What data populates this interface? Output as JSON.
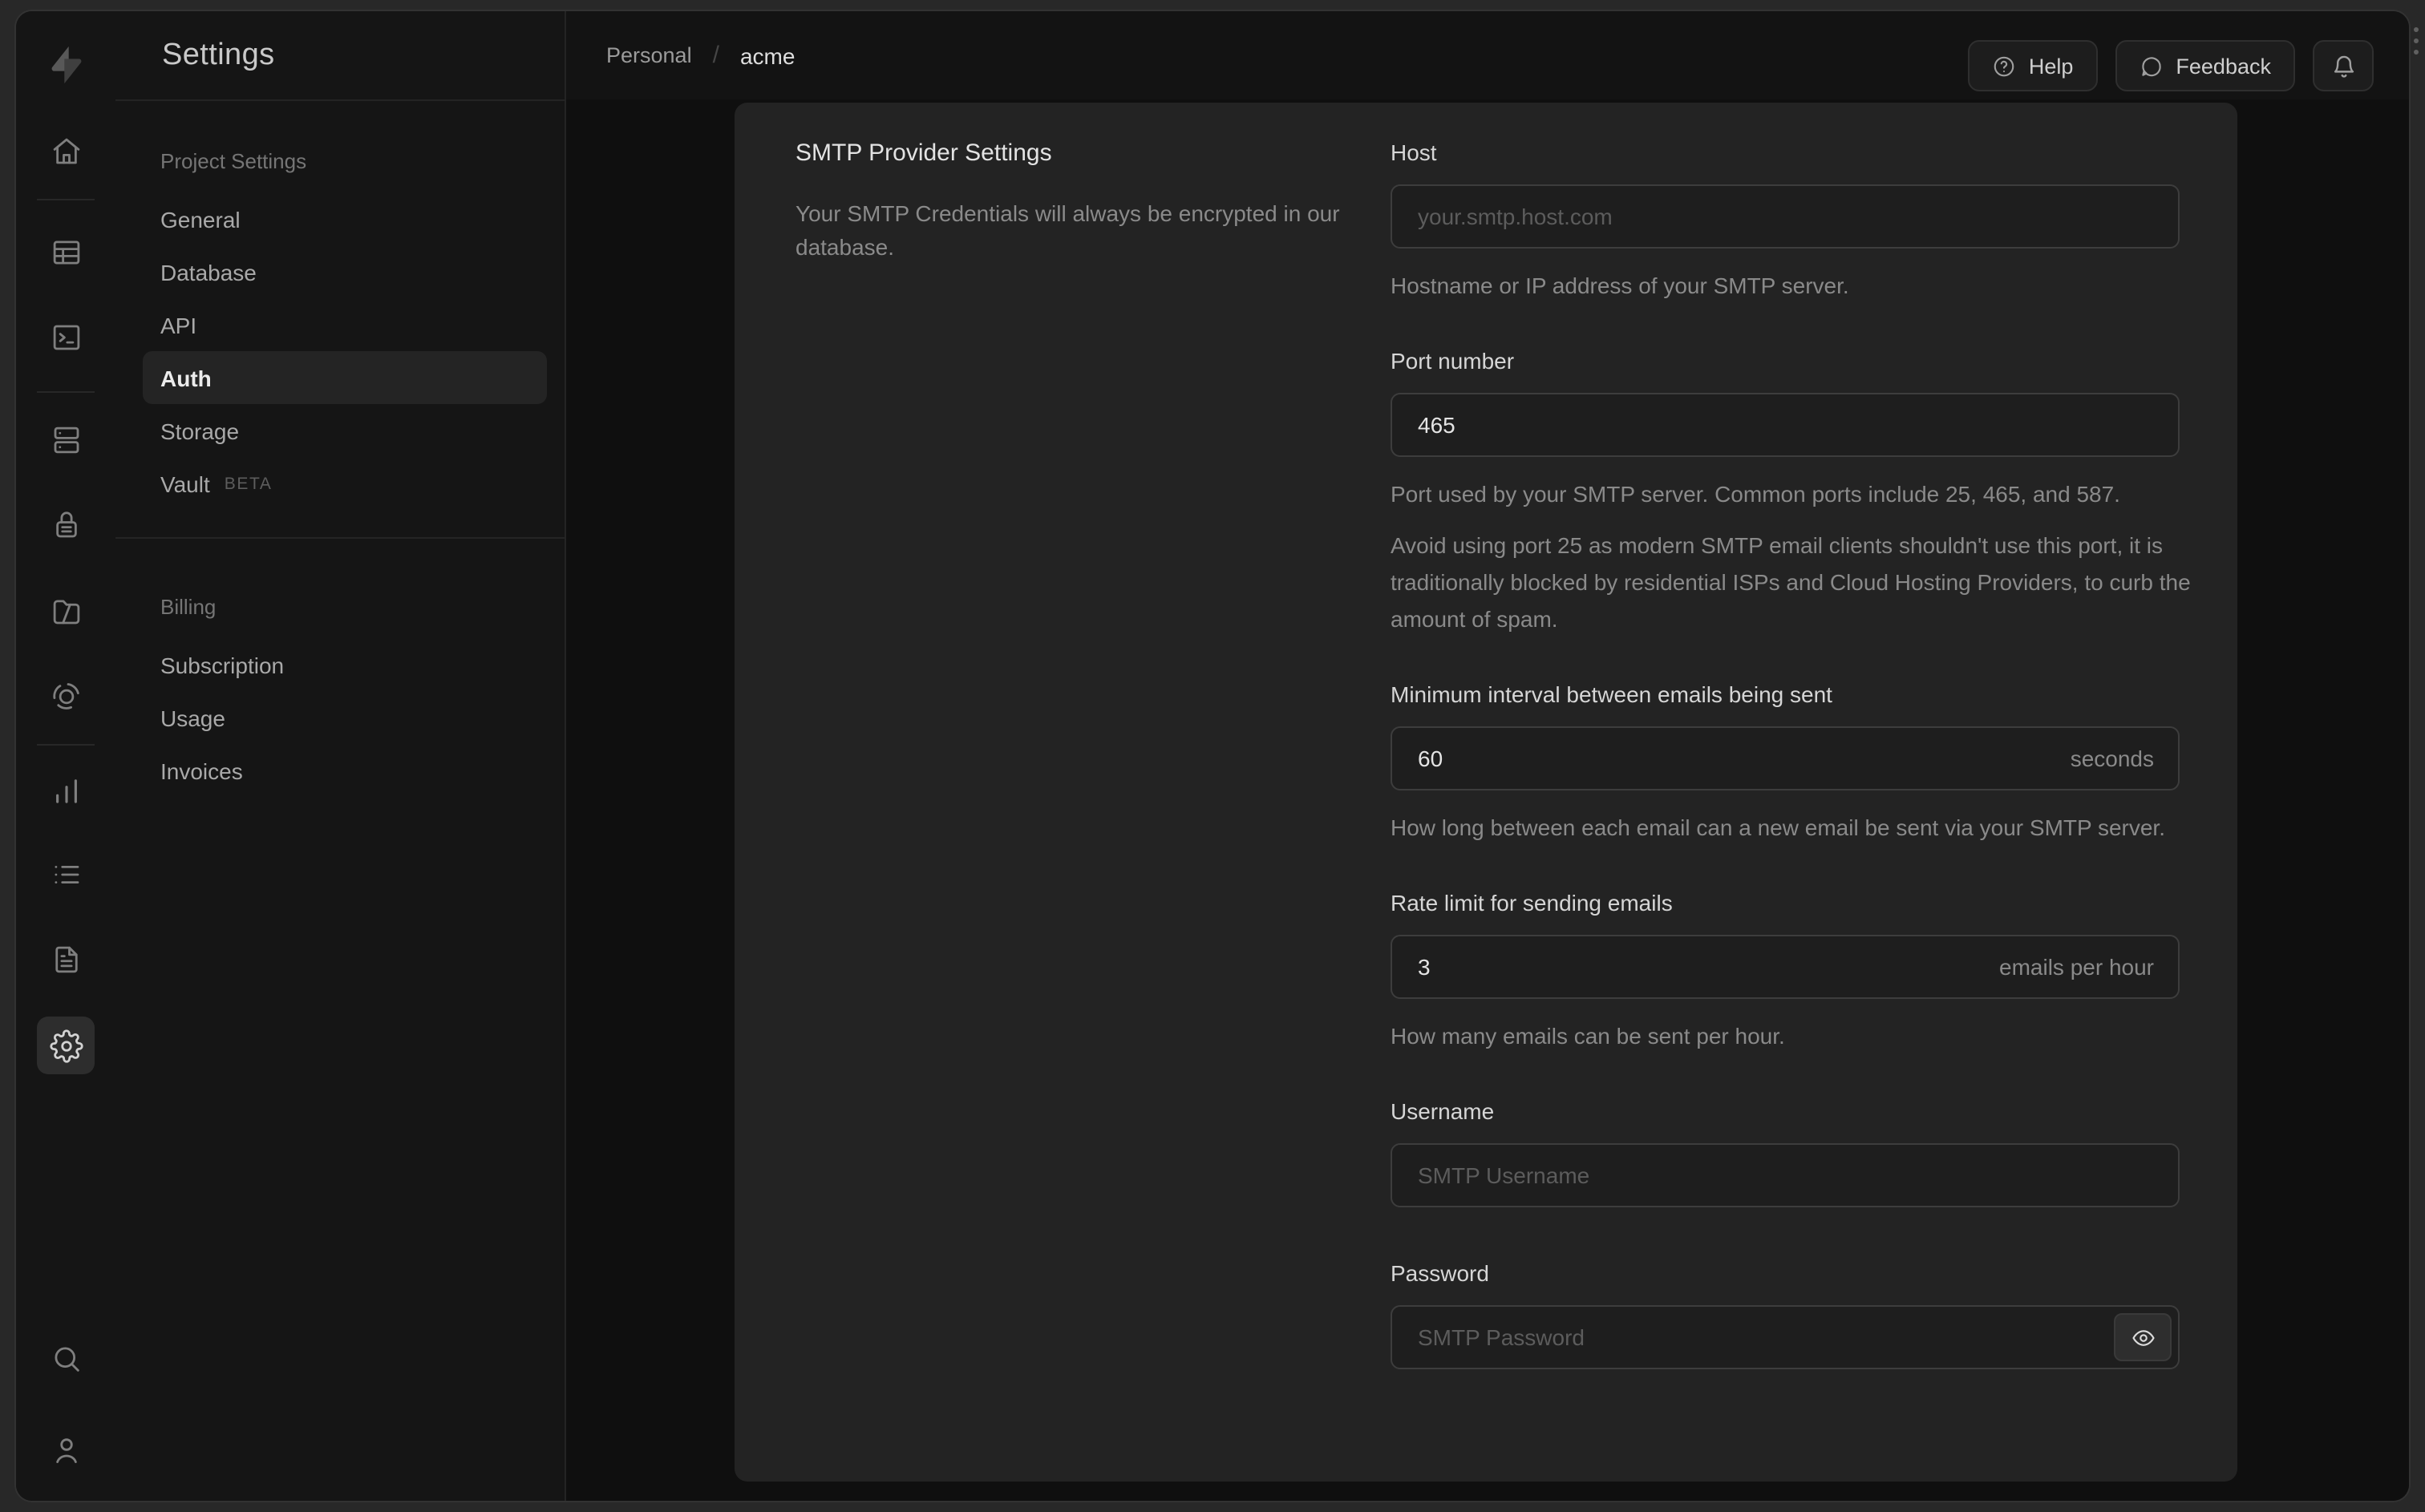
{
  "sidebar": {
    "title": "Settings",
    "sections": [
      {
        "label": "Project Settings",
        "items": [
          {
            "label": "General"
          },
          {
            "label": "Database"
          },
          {
            "label": "API"
          },
          {
            "label": "Auth",
            "active": true
          },
          {
            "label": "Storage"
          },
          {
            "label": "Vault",
            "badge": "BETA"
          }
        ]
      },
      {
        "label": "Billing",
        "items": [
          {
            "label": "Subscription"
          },
          {
            "label": "Usage"
          },
          {
            "label": "Invoices"
          }
        ]
      }
    ]
  },
  "rail": {
    "icons": [
      "supabase-logo",
      "home",
      "table-editor",
      "sql-editor",
      "database",
      "auth",
      "storage",
      "edge-functions",
      "reports",
      "logs",
      "api-docs",
      "project-settings",
      "search",
      "profile"
    ]
  },
  "header": {
    "breadcrumb": {
      "org": "Personal",
      "separator": "/",
      "project": "acme"
    },
    "help_label": "Help",
    "feedback_label": "Feedback"
  },
  "panel": {
    "title": "SMTP Provider Settings",
    "description": "Your SMTP Credentials will always be encrypted in our database.",
    "fields": {
      "host": {
        "label": "Host",
        "placeholder": "your.smtp.host.com",
        "helper": "Hostname or IP address of your SMTP server."
      },
      "port": {
        "label": "Port number",
        "value": "465",
        "helper1": "Port used by your SMTP server. Common ports include 25, 465, and 587.",
        "helper2": "Avoid using port 25 as modern SMTP email clients shouldn't use this port, it is traditionally blocked by residential ISPs and Cloud Hosting Providers, to curb the amount of spam."
      },
      "interval": {
        "label": "Minimum interval between emails being sent",
        "value": "60",
        "suffix": "seconds",
        "helper": "How long between each email can a new email be sent via your SMTP server."
      },
      "rate": {
        "label": "Rate limit for sending emails",
        "value": "3",
        "suffix": "emails per hour",
        "helper": "How many emails can be sent per hour."
      },
      "username": {
        "label": "Username",
        "placeholder": "SMTP Username"
      },
      "password": {
        "label": "Password",
        "placeholder": "SMTP Password"
      }
    }
  },
  "colors": {
    "frame": "#282828",
    "window_bg": "#131313",
    "sidebar_bg": "#151515",
    "page_bg": "#0f0f0f",
    "panel_bg": "#232323",
    "input_bg": "#1e1e1e",
    "input_border": "#3d3d3d",
    "active_item_bg": "#242424",
    "text_primary": "#e4e4e4",
    "text_muted": "#8a8a8a"
  }
}
